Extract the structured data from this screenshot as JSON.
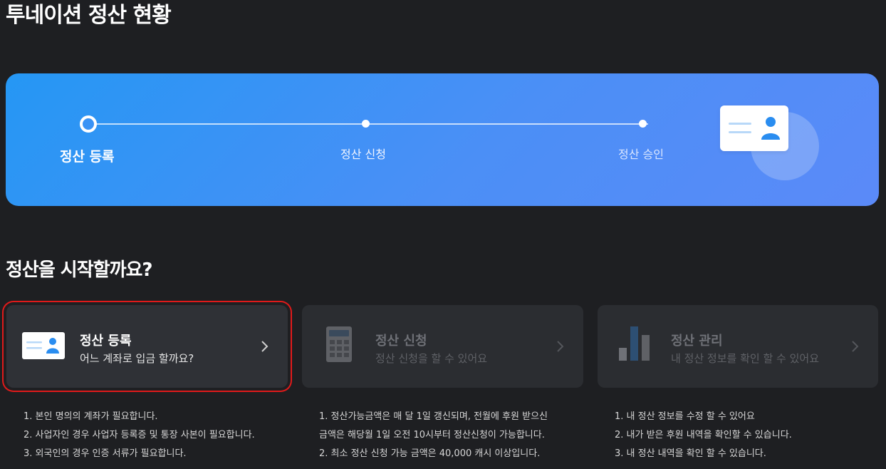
{
  "page": {
    "title": "투네이션 정산 현황"
  },
  "progress": {
    "steps": [
      {
        "label": "정산 등록",
        "state": "current"
      },
      {
        "label": "정산 신청",
        "state": "pending"
      },
      {
        "label": "정산 승인",
        "state": "pending"
      }
    ],
    "colors": {
      "gradient_start": "#2597f4",
      "gradient_end": "#5b8af8"
    },
    "illustration_icon": "id-card-icon"
  },
  "section": {
    "title": "정산을 시작할까요?"
  },
  "cards": [
    {
      "title": "정산 등록",
      "subtitle": "어느 계좌로 입금 할까요?",
      "icon": "id-card-icon",
      "enabled": true
    },
    {
      "title": "정산 신청",
      "subtitle": "정산 신청을 할 수 있어요",
      "icon": "calculator-icon",
      "enabled": false
    },
    {
      "title": "정산 관리",
      "subtitle": "내 정산 정보를 확인 할 수 있어요",
      "icon": "bar-chart-icon",
      "enabled": false
    }
  ],
  "notes": {
    "register": [
      "1. 본인 명의의 계좌가 필요합니다.",
      "2. 사업자인 경우 사업자 등록증 및 통장 사본이 필요합니다.",
      "3. 외국인의 경우 인증 서류가 필요합니다."
    ],
    "apply": [
      "1. 정산가능금액은 매 달 1일 갱신되며, 전월에 후원 받으신",
      "금액은 해당월 1일 오전 10시부터 정산신청이 가능합니다.",
      "2. 최소 정산 신청 가능 금액은 40,000 캐시 이상입니다."
    ],
    "manage": [
      "1. 내 정산 정보를 수정 할 수 있어요",
      "2. 내가 받은 후원 내역을 확인할 수 있습니다.",
      "3. 내 정산 내역을 확인 할 수 있습니다."
    ]
  },
  "colors": {
    "background": "#1e1f22",
    "card": "#2b2d31",
    "highlight": "#e01a1a",
    "accent": "#2a8df0"
  }
}
